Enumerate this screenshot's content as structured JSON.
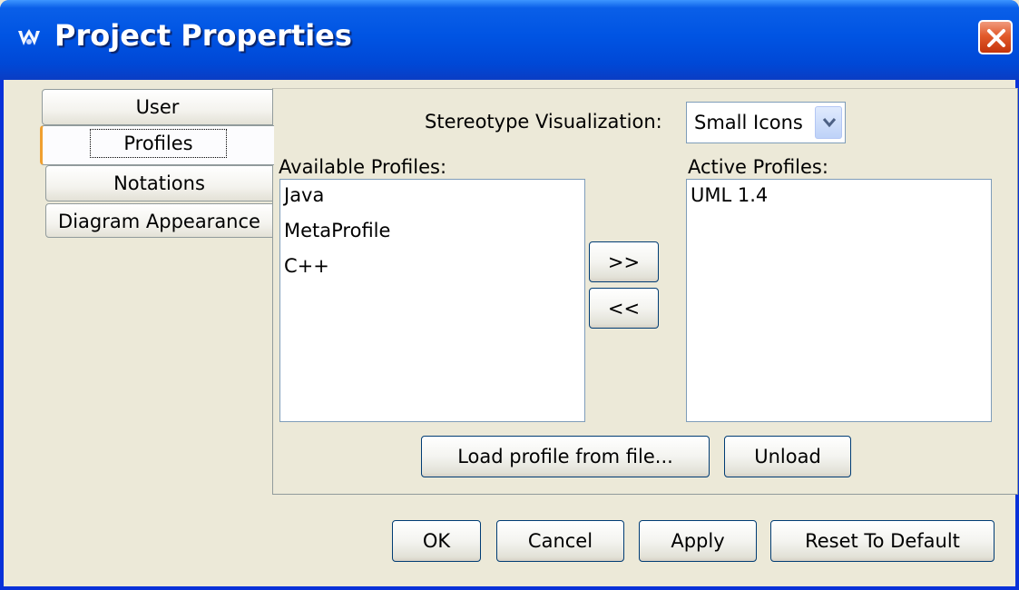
{
  "window": {
    "title": "Project Properties"
  },
  "tabs": [
    {
      "label": "User",
      "selected": false
    },
    {
      "label": "Profiles",
      "selected": true
    },
    {
      "label": "Notations",
      "selected": false
    },
    {
      "label": "Diagram Appearance",
      "selected": false
    }
  ],
  "profiles": {
    "stereotype_label": "Stereotype Visualization:",
    "stereotype_value": "Small Icons",
    "available_label": "Available Profiles:",
    "available_items": [
      "Java",
      "MetaProfile",
      "C++"
    ],
    "active_label": "Active Profiles:",
    "active_items": [
      "UML 1.4"
    ],
    "add_label": ">>",
    "remove_label": "<<",
    "load_label": "Load profile from file...",
    "unload_label": "Unload"
  },
  "footer": {
    "ok": "OK",
    "cancel": "Cancel",
    "apply": "Apply",
    "reset": "Reset To Default"
  },
  "colors": {
    "titlebar": "#0054e3",
    "face": "#ece9d8",
    "close": "#e25a2b",
    "selected_tab_accent": "#f0a030"
  }
}
